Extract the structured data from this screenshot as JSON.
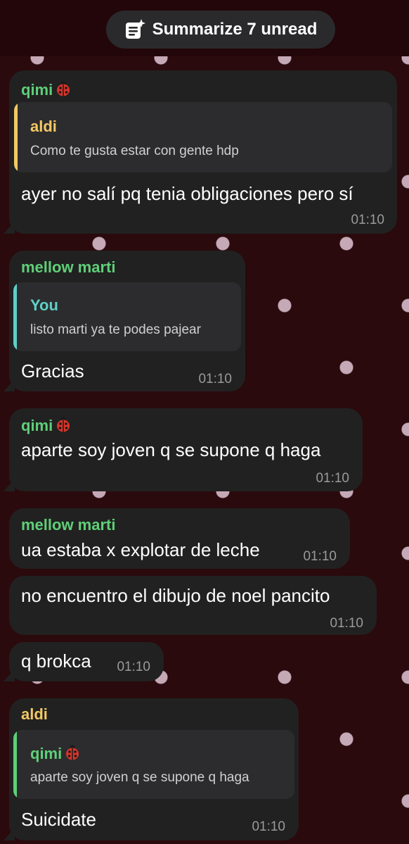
{
  "header": {
    "summarize_label": "Summarize 7 unread",
    "icon": "summary-sparkle-icon"
  },
  "colors": {
    "background": "#2a0a0d",
    "bubble": "#212121",
    "green_name": "#5fcf78",
    "yellow_name": "#f2c864",
    "teal_name": "#5ed0c8",
    "time": "#9a9a9a"
  },
  "messages": [
    {
      "sender": "qimi",
      "sender_emoji": "ladybug",
      "quote": {
        "name": "aldi",
        "text": "Como te gusta estar con gente hdp"
      },
      "text": "ayer no salí pq tenia obligaciones pero sí",
      "time": "01:10"
    },
    {
      "sender": "mellow marti",
      "quote": {
        "name": "You",
        "text": "listo marti ya te podes pajear"
      },
      "text": "Gracias",
      "time": "01:10"
    },
    {
      "sender": "qimi",
      "sender_emoji": "ladybug",
      "text": "aparte soy joven q se supone q haga",
      "time": "01:10"
    },
    {
      "sender": "mellow marti",
      "text": "ua estaba x explotar de leche",
      "time": "01:10"
    },
    {
      "text": "no encuentro el dibujo de noel pancito",
      "time": "01:10"
    },
    {
      "text": "q brokca",
      "time": "01:10"
    },
    {
      "sender": "aldi",
      "quote": {
        "name": "qimi",
        "name_emoji": "ladybug",
        "text": "aparte soy joven q se supone q haga"
      },
      "text": "Suicidate",
      "time": "01:10"
    }
  ]
}
